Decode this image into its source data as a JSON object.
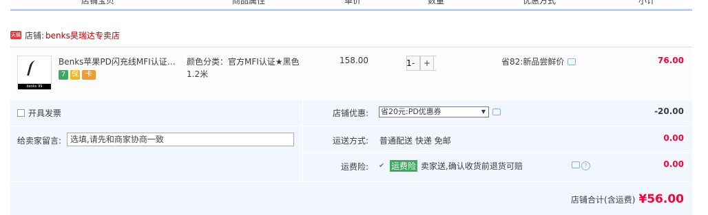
{
  "header": {
    "cols": [
      "店铺宝贝",
      "商品属性",
      "单价",
      "数量",
      "优惠方式",
      "小计"
    ]
  },
  "shop": {
    "icon": "tmall-icon",
    "icon_text": "天猫",
    "label": "店铺:",
    "name": "benks昊瑞达专卖店"
  },
  "item": {
    "title": "Benks苹果PD闪充线MFI认证数据线",
    "thumb_text": "benks 99",
    "badges": [
      {
        "text": "7",
        "color": "#3dab5f"
      },
      {
        "text": "保",
        "color": "#efb919"
      },
      {
        "text": "卡",
        "color": "#f59b2e"
      }
    ],
    "attr": "颜色分类：官方MFI认证★黑色1.2米",
    "price": "158.00",
    "qty": "1",
    "qty_minus": "-",
    "qty_plus": "+",
    "promo": "省82:新品尝鲜价",
    "subtotal": "76.00"
  },
  "options": {
    "invoice": "开具发票",
    "message_label": "给卖家留言:",
    "message_placeholder": "选填,请先和商家协商一致",
    "shop_discount_label": "店铺优惠:",
    "shop_discount_value": "省20元:PD优惠券",
    "shop_discount_amount": "-20.00",
    "shipping_label": "运送方式:",
    "shipping_value": "普通配送 快递 免邮",
    "shipping_amount": "0.00",
    "insurance_label": "运费险:",
    "insurance_tag": "运费险",
    "insurance_text": "卖家送,确认收货前退货可赔",
    "insurance_amount": "0.00"
  },
  "total": {
    "label": "店铺合计(含运费)",
    "amount": "¥56.00"
  },
  "colors": {
    "accent_red": "#ff0036",
    "panel_bg": "#f2f7ff",
    "header_line": "#b2d1ff"
  }
}
